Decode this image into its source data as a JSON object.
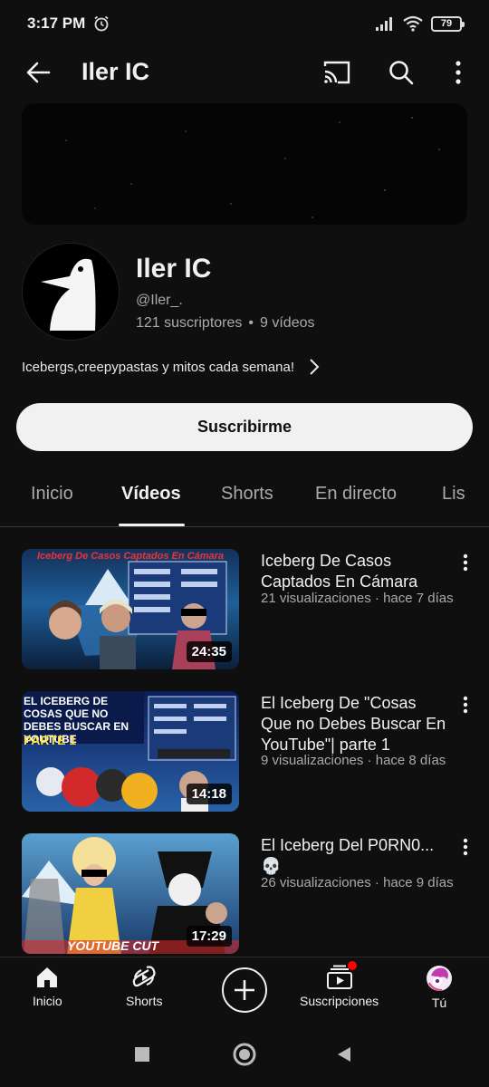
{
  "status_bar": {
    "time": "3:17 PM",
    "battery": "79"
  },
  "header": {
    "title": "Iler IC"
  },
  "channel": {
    "name": "Iler IC",
    "handle": "@Iler_.",
    "subscribers": "121 suscriptores",
    "separator": "•",
    "videos_count": "9 vídeos",
    "description": "Icebergs,creepypastas y mitos cada semana!"
  },
  "subscribe_label": "Suscribirme",
  "tabs": [
    {
      "label": "Inicio",
      "active": false
    },
    {
      "label": "Vídeos",
      "active": true
    },
    {
      "label": "Shorts",
      "active": false
    },
    {
      "label": "En directo",
      "active": false
    },
    {
      "label": "Lis",
      "active": false
    }
  ],
  "videos": [
    {
      "title": "Iceberg De Casos Captados En Cámara",
      "meta": "21 visualizaciones · hace 7 días",
      "duration": "24:35",
      "thumb_text": "Iceberg De Casos Captados En Cámara"
    },
    {
      "title": "El Iceberg De \"Cosas Que no Debes Buscar En YouTube\"| parte 1",
      "meta": "9 visualizaciones · hace 8 días",
      "duration": "14:18",
      "thumb_text": "EL ICEBERG DE COSAS QUE NO DEBES BUSCAR EN YOUTUBE",
      "thumb_text2": "PARTE 1"
    },
    {
      "title": "El Iceberg Del P0RN0... 💀",
      "meta": "26 visualizaciones · hace 9 días",
      "duration": "17:29",
      "thumb_text": "YOUTUBE CUT"
    }
  ],
  "bottom_nav": [
    {
      "label": "Inicio",
      "icon": "home-icon"
    },
    {
      "label": "Shorts",
      "icon": "shorts-icon"
    },
    {
      "label": "",
      "icon": "create-icon"
    },
    {
      "label": "Suscripciones",
      "icon": "subscriptions-icon"
    },
    {
      "label": "Tú",
      "icon": "avatar-icon"
    }
  ],
  "colors": {
    "background": "#0f0f0f",
    "text_primary": "#f1f1f1",
    "text_secondary": "#aaaaaa",
    "accent_red": "#ff0000"
  }
}
